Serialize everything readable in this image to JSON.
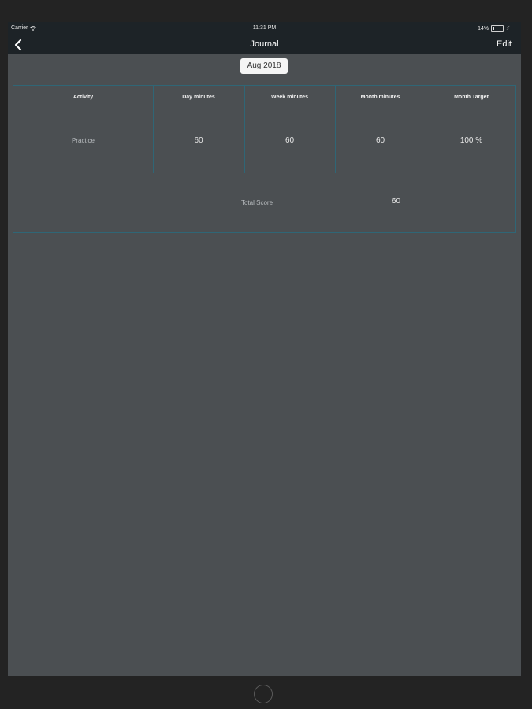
{
  "status_bar": {
    "carrier": "Carrier",
    "time": "11:31 PM",
    "battery_text": "14%",
    "battery_level": 0.14,
    "icons": [
      "wifi-icon",
      "battery-icon",
      "charging-icon"
    ]
  },
  "nav": {
    "title": "Journal",
    "edit_label": "Edit",
    "back_icon": "chevron-left-icon"
  },
  "date_selector": {
    "label": "Aug 2018"
  },
  "table": {
    "headers": [
      "Activity",
      "Day minutes",
      "Week minutes",
      "Month minutes",
      "Month Target"
    ],
    "rows": [
      {
        "activity": "Practice",
        "day": "60",
        "week": "60",
        "month": "60",
        "target": "100 %"
      }
    ],
    "total_label": "Total Score",
    "total_value": "60"
  },
  "colors": {
    "background": "#4b4f52",
    "bar": "#1d2327",
    "grid_line": "#2f6676",
    "text": "#e8e8e8"
  }
}
